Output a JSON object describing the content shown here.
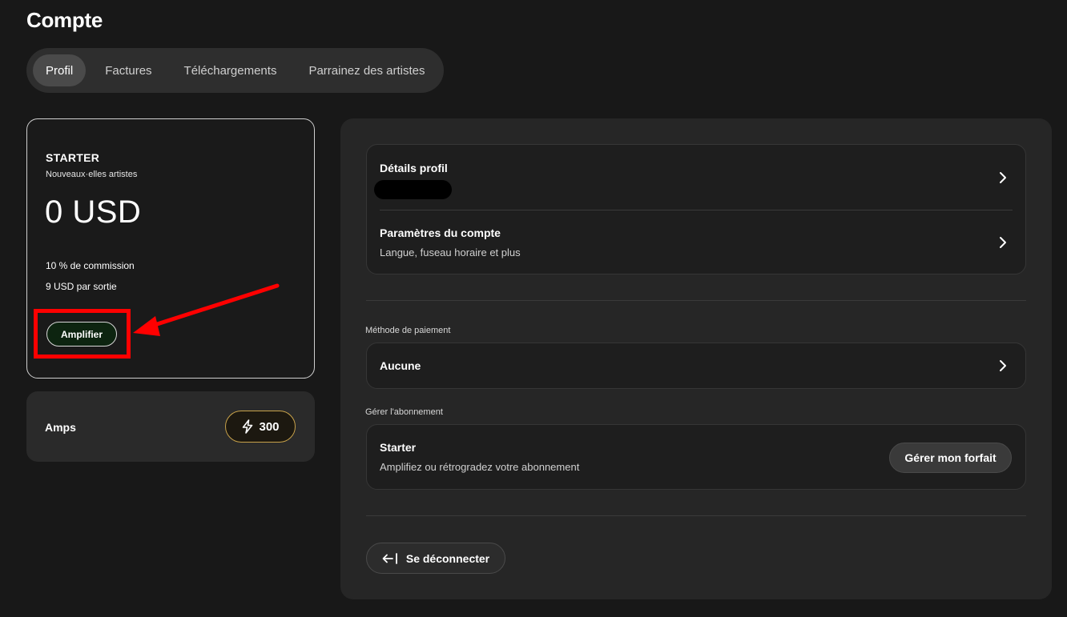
{
  "page": {
    "title": "Compte"
  },
  "tabs": [
    {
      "label": "Profil",
      "active": true
    },
    {
      "label": "Factures",
      "active": false
    },
    {
      "label": "Téléchargements",
      "active": false
    },
    {
      "label": "Parrainez des artistes",
      "active": false
    }
  ],
  "plan": {
    "name": "STARTER",
    "subtitle": "Nouveaux·elles artistes",
    "price": "0 USD",
    "features": [
      "10 % de commission",
      "9 USD par sortie"
    ],
    "cta_label": "Amplifier"
  },
  "amps": {
    "label": "Amps",
    "value": "300",
    "icon": "lightning-icon",
    "accent": "#c8a24a"
  },
  "profile": {
    "details_title": "Détails profil",
    "settings_title": "Paramètres du compte",
    "settings_subtitle": "Langue, fuseau horaire et plus"
  },
  "payment": {
    "section_label": "Méthode de paiement",
    "value": "Aucune"
  },
  "subscription": {
    "section_label": "Gérer l'abonnement",
    "title": "Starter",
    "subtitle": "Amplifiez ou rétrogradez votre abonnement",
    "button_label": "Gérer mon forfait"
  },
  "logout": {
    "label": "Se déconnecter",
    "icon": "logout-arrow-icon"
  },
  "annotation": {
    "color": "#ff0000"
  }
}
